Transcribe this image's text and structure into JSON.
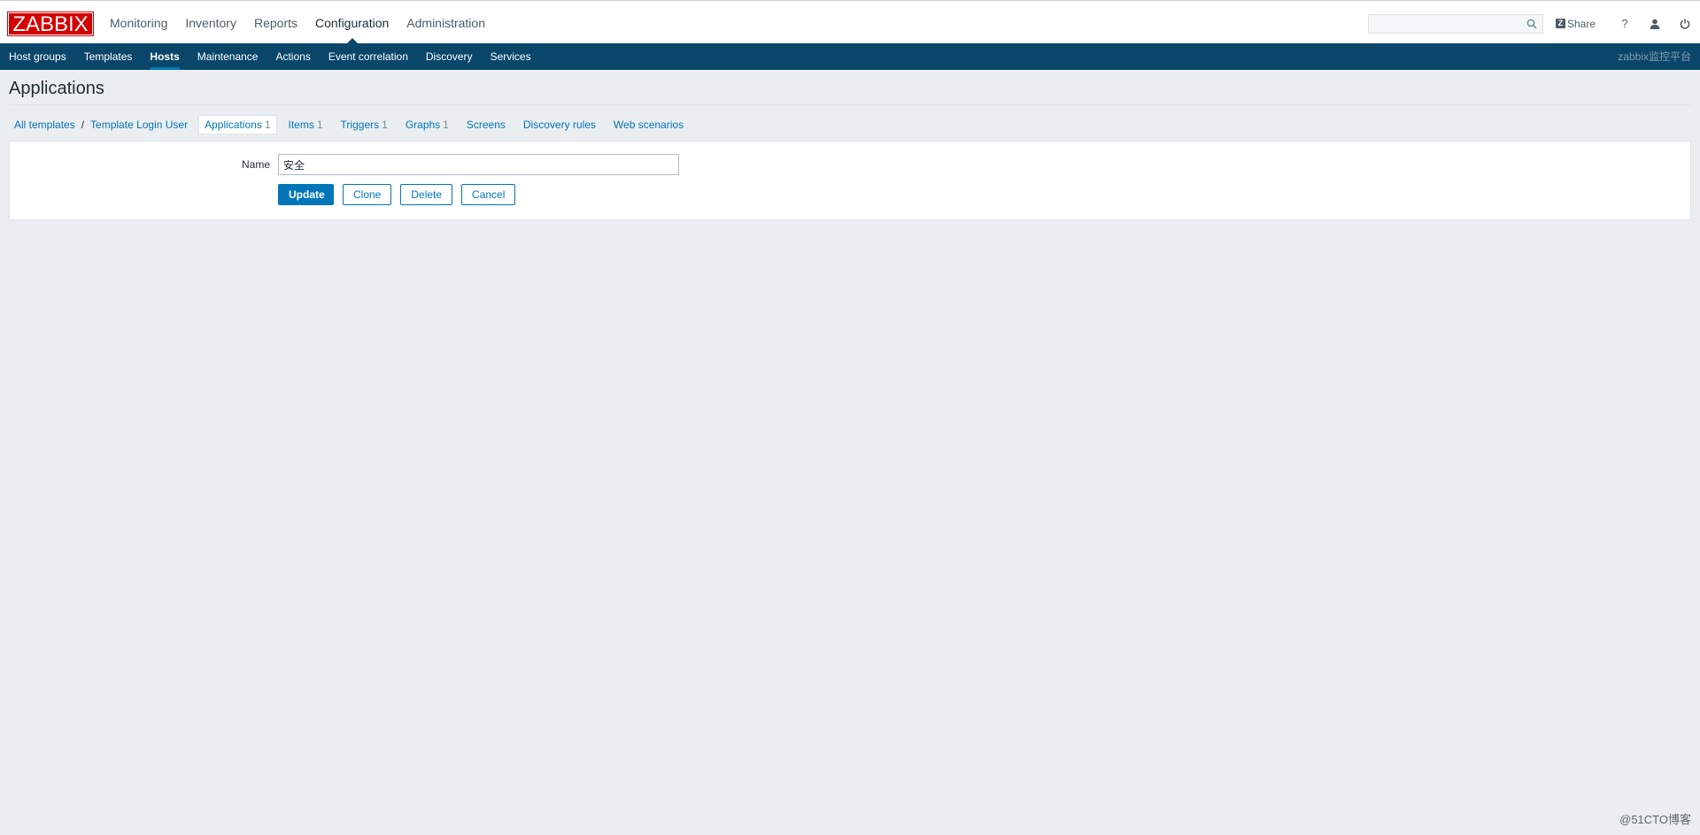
{
  "header": {
    "logo": "ZABBIX",
    "menu": [
      {
        "label": "Monitoring"
      },
      {
        "label": "Inventory"
      },
      {
        "label": "Reports"
      },
      {
        "label": "Configuration"
      },
      {
        "label": "Administration"
      }
    ],
    "active_menu": "Configuration",
    "search": {
      "value": "",
      "placeholder": ""
    },
    "share_label": "Share",
    "help_icon": "question-icon",
    "user_icon": "user-icon",
    "logout_icon": "power-icon"
  },
  "subnav": {
    "items": [
      {
        "label": "Host groups"
      },
      {
        "label": "Templates"
      },
      {
        "label": "Hosts"
      },
      {
        "label": "Maintenance"
      },
      {
        "label": "Actions"
      },
      {
        "label": "Event correlation"
      },
      {
        "label": "Discovery"
      },
      {
        "label": "Services"
      }
    ],
    "active": "Hosts",
    "server_name": "zabbix监控平台"
  },
  "page": {
    "title": "Applications"
  },
  "breadcrumbs": {
    "all_templates": "All templates",
    "separator": "/",
    "template": "Template Login User",
    "tabs": [
      {
        "label": "Applications",
        "count": "1"
      },
      {
        "label": "Items",
        "count": "1"
      },
      {
        "label": "Triggers",
        "count": "1"
      },
      {
        "label": "Graphs",
        "count": "1"
      },
      {
        "label": "Screens",
        "count": ""
      },
      {
        "label": "Discovery rules",
        "count": ""
      },
      {
        "label": "Web scenarios",
        "count": ""
      }
    ],
    "selected_tab": "Applications"
  },
  "form": {
    "name_label": "Name",
    "name_value": "安全",
    "update_label": "Update",
    "clone_label": "Clone",
    "delete_label": "Delete",
    "cancel_label": "Cancel"
  },
  "watermark": "@51CTO博客",
  "colors": {
    "brand": "#d40000",
    "nav": "#0a466a",
    "link": "#0275b8",
    "background": "#ebeef0"
  }
}
